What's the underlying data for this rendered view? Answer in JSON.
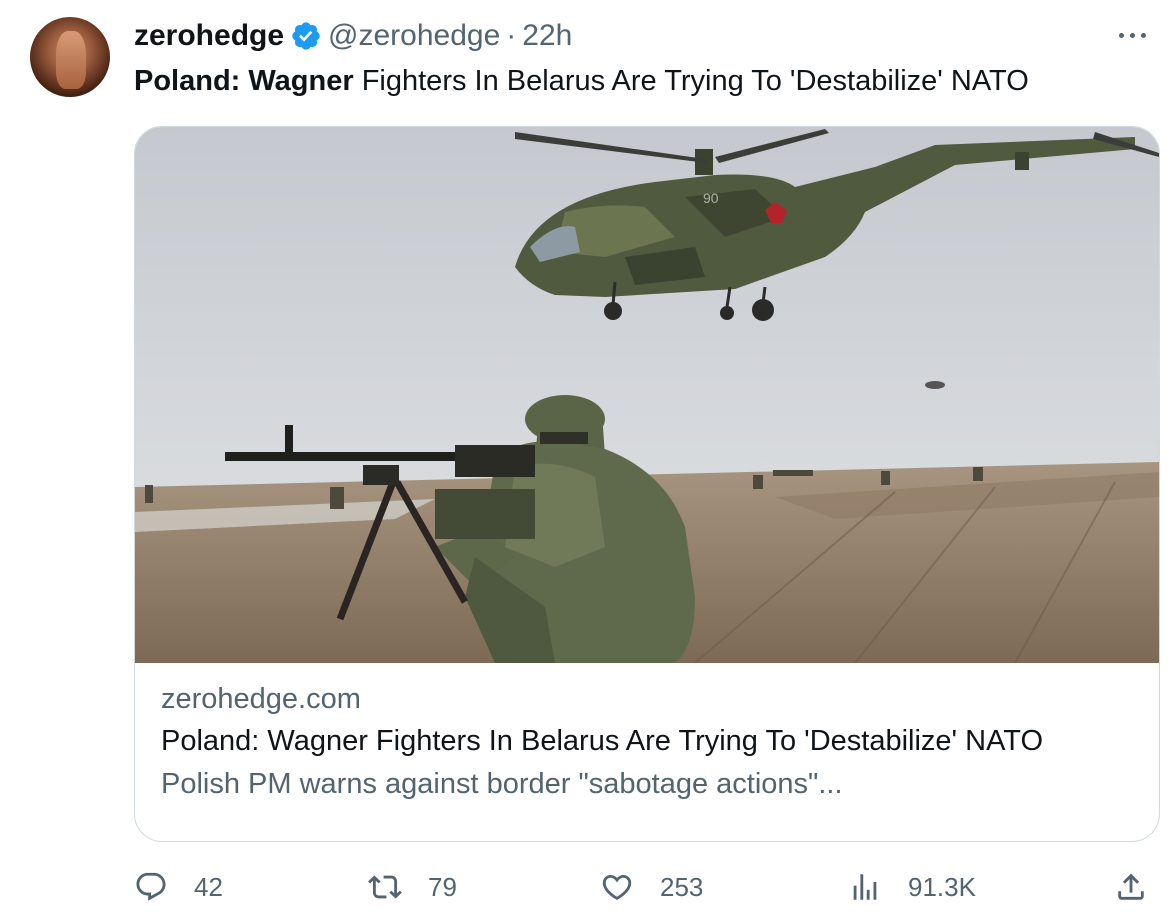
{
  "author": {
    "name": "zerohedge",
    "handle": "@zerohedge",
    "separator": "·",
    "time": "22h"
  },
  "tweet": {
    "bold_prefix": "Poland: Wagner",
    "text_rest": " Fighters In Belarus Are Trying To 'Destabilize' NATO"
  },
  "card": {
    "domain": "zerohedge.com",
    "title": "Poland: Wagner Fighters In Belarus Are Trying To 'Destabilize' NATO",
    "description": "Polish PM warns against border \"sabotage actions\"...",
    "image_marking": "90"
  },
  "actions": {
    "replies": "42",
    "retweets": "79",
    "likes": "253",
    "views": "91.3K"
  },
  "colors": {
    "text_primary": "#0f1419",
    "text_secondary": "#536471",
    "verified_blue": "#1d9bf0",
    "card_border": "#cfd9de"
  },
  "icons": [
    "verified-badge-icon",
    "more-options-icon",
    "reply-icon",
    "retweet-icon",
    "like-icon",
    "views-icon",
    "share-icon"
  ]
}
